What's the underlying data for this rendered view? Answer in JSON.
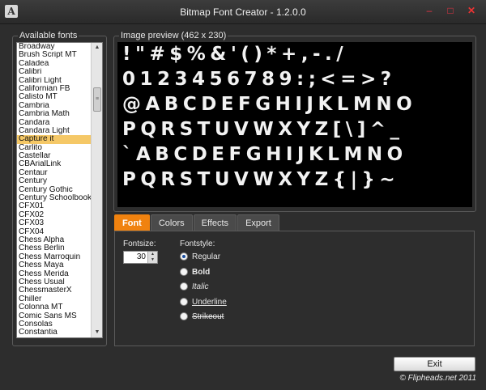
{
  "window": {
    "title": "Bitmap Font Creator - 1.2.0.0",
    "icon_letter": "A",
    "minimize": "–",
    "maximize": "□",
    "close": "✕"
  },
  "fonts_panel": {
    "label": "Available fonts",
    "items": [
      "Broadway",
      "Brush Script MT",
      "Caladea",
      "Calibri",
      "Calibri Light",
      "Californian FB",
      "Calisto MT",
      "Cambria",
      "Cambria Math",
      "Candara",
      "Candara Light",
      "Capture it",
      "Carlito",
      "Castellar",
      "CBArialLink",
      "Centaur",
      "Century",
      "Century Gothic",
      "Century Schoolbook",
      "CFX01",
      "CFX02",
      "CFX03",
      "CFX04",
      "Chess Alpha",
      "Chess Berlin",
      "Chess Marroquin",
      "Chess Maya",
      "Chess Merida",
      "Chess Usual",
      "ChessmasterX",
      "Chiller",
      "Colonna MT",
      "Comic Sans MS",
      "Consolas",
      "Constantia"
    ],
    "selected_index": 11,
    "scroll_up": "▲",
    "scroll_down": "▼",
    "scroll_thumb": "≡"
  },
  "preview": {
    "label": "Image preview (462 x 230)",
    "rows": [
      "!\"#$%&'()*+,-./",
      "0123456789:;<=>?",
      "@ABCDEFGHIJKLMNO",
      "PQRSTUVWXYZ[\\]^_",
      "`ABCDEFGHIJKLMNO",
      "PQRSTUVWXYZ{|}~"
    ]
  },
  "tabs": [
    {
      "label": "Font",
      "active": true
    },
    {
      "label": "Colors",
      "active": false
    },
    {
      "label": "Effects",
      "active": false
    },
    {
      "label": "Export",
      "active": false
    }
  ],
  "font_tab": {
    "fontsize_label": "Fontsize:",
    "fontsize_value": "30",
    "spin_up": "▲",
    "spin_down": "▼",
    "fontstyle_label": "Fontstyle:",
    "styles": [
      {
        "label": "Regular",
        "checked": true
      },
      {
        "label": "Bold",
        "checked": false
      },
      {
        "label": "Italic",
        "checked": false
      },
      {
        "label": "Underline",
        "checked": false
      },
      {
        "label": "Strikeout",
        "checked": false
      }
    ]
  },
  "footer": {
    "exit_label": "Exit",
    "copyright": "© Flipheads.net 2011"
  }
}
